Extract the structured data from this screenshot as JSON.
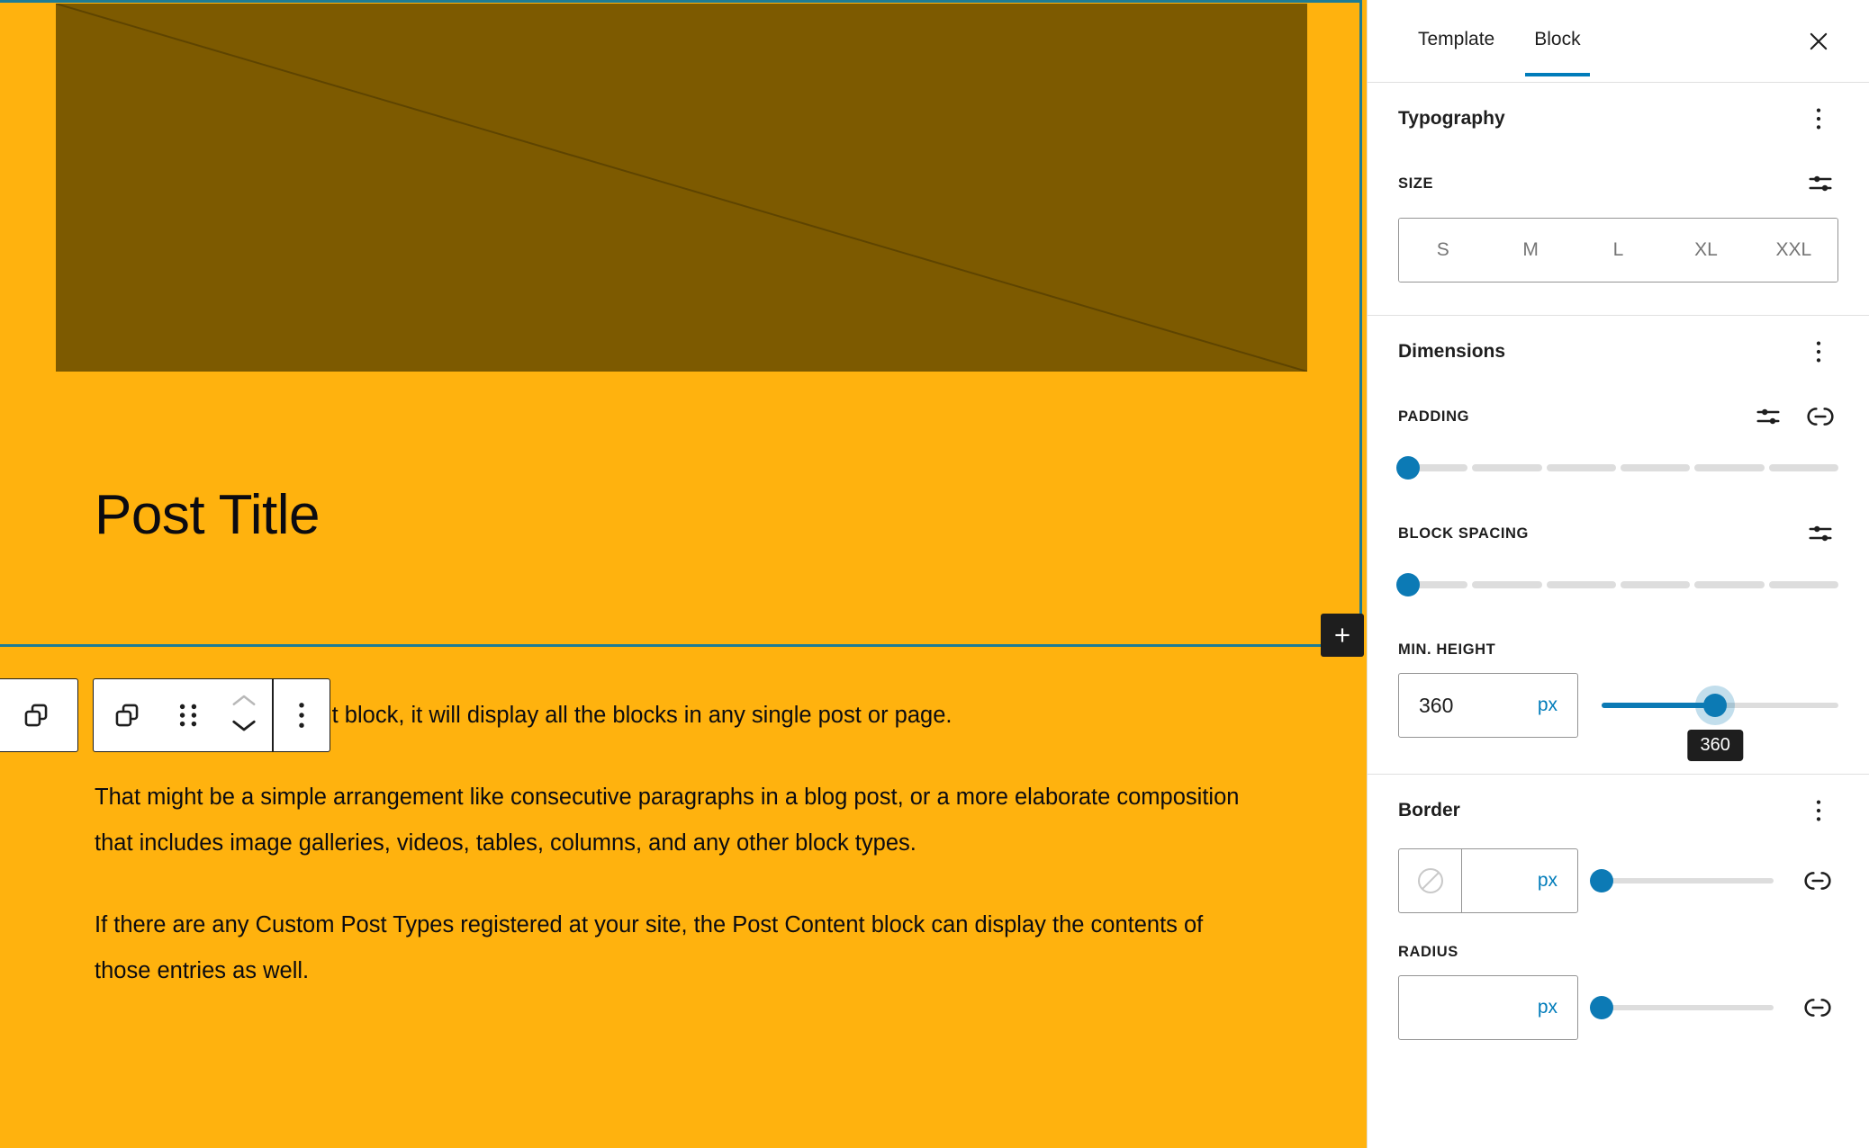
{
  "editor": {
    "canvas_bg": "#FFB20E",
    "selection_color": "#1d7c96",
    "featured_image": {
      "name": "featured-image-placeholder",
      "fill": "#7d5a00"
    },
    "post_title": "Post Title",
    "appender_label": "+",
    "block_toolbar": {
      "parent_block_label": "Select parent block",
      "block_type_label": "Post Content",
      "drag_label": "Drag",
      "move_up_label": "Move up",
      "move_down_label": "Move down",
      "more_label": "Options"
    },
    "paragraphs": [
      "This is the Post Content block, it will display all the blocks in any single post or page.",
      "That might be a simple arrangement like consecutive paragraphs in a blog post, or a more elaborate composition that includes image galleries, videos, tables, columns, and any other block types.",
      "If there are any Custom Post Types registered at your site, the Post Content block can display the contents of those entries as well."
    ]
  },
  "sidebar": {
    "tabs": [
      {
        "label": "Template",
        "active": false
      },
      {
        "label": "Block",
        "active": true
      }
    ],
    "close_label": "Close Settings",
    "accent": "#007cba",
    "typography": {
      "title": "Typography",
      "size_label": "Size",
      "size_options": [
        "S",
        "M",
        "L",
        "XL",
        "XXL"
      ]
    },
    "dimensions": {
      "title": "Dimensions",
      "padding_label": "Padding",
      "padding_value": 0,
      "block_spacing_label": "Block spacing",
      "block_spacing_value": 0,
      "min_height_label": "Min. Height",
      "min_height_value": "360",
      "min_height_unit": "px",
      "min_height_tooltip": "360"
    },
    "border": {
      "title": "Border",
      "width_value": "",
      "width_unit": "px",
      "color_swatch": "none",
      "radius_label": "Radius",
      "radius_value": "",
      "radius_unit": "px"
    }
  }
}
